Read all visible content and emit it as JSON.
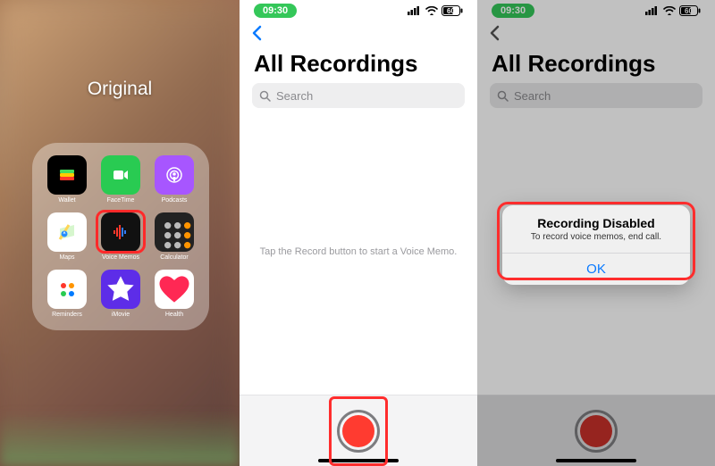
{
  "panel1": {
    "label": "Original",
    "apps": [
      {
        "name": "Wallet"
      },
      {
        "name": "FaceTime"
      },
      {
        "name": "Podcasts"
      },
      {
        "name": "Maps"
      },
      {
        "name": "Voice Memos"
      },
      {
        "name": "Calculator"
      },
      {
        "name": "Reminders"
      },
      {
        "name": "iMovie"
      },
      {
        "name": "Health"
      }
    ]
  },
  "statusbar": {
    "time": "09:30",
    "battery": "60"
  },
  "voicememos": {
    "title": "All Recordings",
    "search_placeholder": "Search",
    "hint": "Tap the Record button to start a Voice Memo."
  },
  "alert": {
    "title": "Recording Disabled",
    "message": "To record voice memos, end call.",
    "ok": "OK"
  }
}
